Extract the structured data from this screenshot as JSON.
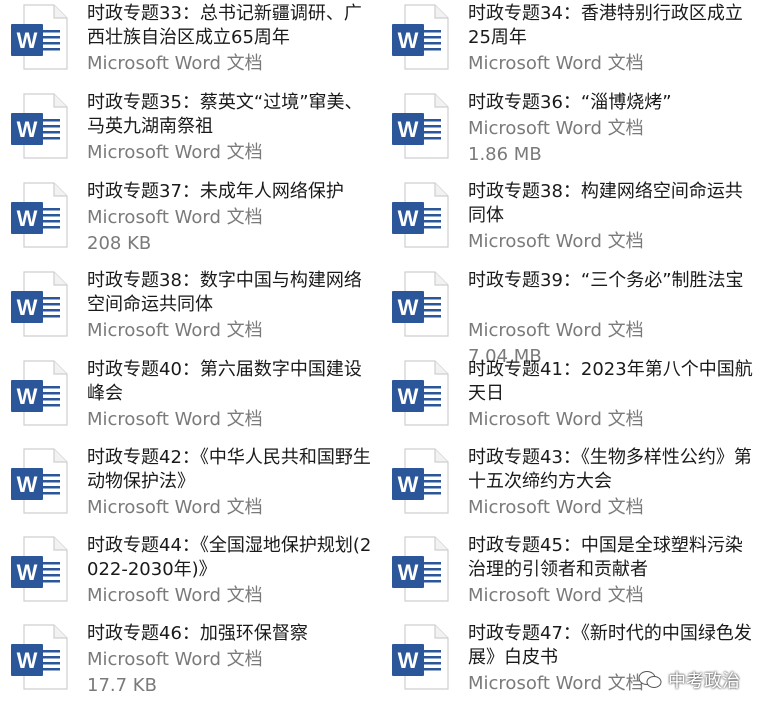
{
  "files": [
    {
      "name": "时政专题33：总书记新疆调研、广西壮族自治区成立65周年",
      "type": "Microsoft Word 文档",
      "size": ""
    },
    {
      "name": "时政专题34：香港特别行政区成立25周年",
      "type": "Microsoft Word 文档",
      "size": ""
    },
    {
      "name": "时政专题35：蔡英文“过境”窜美、马英九湖南祭祖",
      "type": "Microsoft Word 文档",
      "size": ""
    },
    {
      "name": "时政专题36：“淄博烧烤”",
      "type": "Microsoft Word 文档",
      "size": "1.86 MB"
    },
    {
      "name": "时政专题37：未成年人网络保护",
      "type": "Microsoft Word 文档",
      "size": "208 KB"
    },
    {
      "name": "时政专题38：构建网络空间命运共同体",
      "type": "Microsoft Word 文档",
      "size": ""
    },
    {
      "name": "时政专题38：数字中国与构建网络空间命运共同体",
      "type": "Microsoft Word 文档",
      "size": ""
    },
    {
      "name": "时政专题39：“三个务必”制胜法宝",
      "type": "Microsoft Word 文档",
      "size": "7.04 MB"
    },
    {
      "name": "时政专题40：第六届数字中国建设峰会",
      "type": "Microsoft Word 文档",
      "size": ""
    },
    {
      "name": "时政专题41：2023年第八个中国航天日",
      "type": "Microsoft Word 文档",
      "size": ""
    },
    {
      "name": "时政专题42：《中华人民共和国野生动物保护法》",
      "type": "Microsoft Word 文档",
      "size": ""
    },
    {
      "name": "时政专题43：《生物多样性公约》第十五次缔约方大会",
      "type": "Microsoft Word 文档",
      "size": ""
    },
    {
      "name": "时政专题44：《全国湿地保护规划(2022-2030年)》",
      "type": "Microsoft Word 文档",
      "size": ""
    },
    {
      "name": "时政专题45：中国是全球塑料污染治理的引领者和贡献者",
      "type": "Microsoft Word 文档",
      "size": ""
    },
    {
      "name": "时政专题46：加强环保督察",
      "type": "Microsoft Word 文档",
      "size": "17.7 KB"
    },
    {
      "name": "时政专题47：《新时代的中国绿色发展》白皮书",
      "type": "Microsoft Word 文档",
      "size": ""
    }
  ],
  "watermark": {
    "text": "中考政治"
  },
  "colors": {
    "word_blue": "#2b579a",
    "doc_fold": "#cfcfcf",
    "meta_text": "#7a7a7a"
  },
  "icon": "word-document-icon"
}
